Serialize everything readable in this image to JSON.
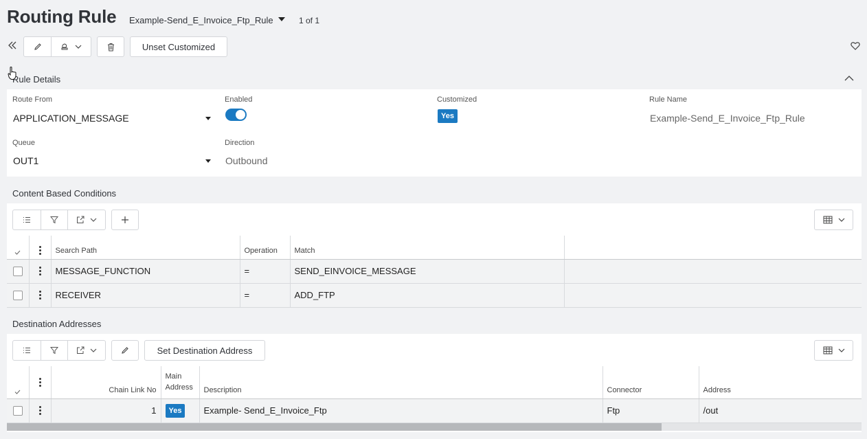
{
  "header": {
    "title": "Routing Rule",
    "record_name": "Example-Send_E_Invoice_Ftp_Rule",
    "paging": "1 of 1"
  },
  "toolbar": {
    "unset_customized_label": "Unset Customized"
  },
  "rule_details": {
    "title": "Rule Details",
    "route_from_label": "Route From",
    "route_from_value": "APPLICATION_MESSAGE",
    "enabled_label": "Enabled",
    "enabled": true,
    "customized_label": "Customized",
    "customized_value": "Yes",
    "rule_name_label": "Rule Name",
    "rule_name_value": "Example-Send_E_Invoice_Ftp_Rule",
    "queue_label": "Queue",
    "queue_value": "OUT1",
    "direction_label": "Direction",
    "direction_value": "Outbound"
  },
  "conditions": {
    "title": "Content Based Conditions",
    "columns": [
      "Search Path",
      "Operation",
      "Match"
    ],
    "rows": [
      {
        "search_path": "MESSAGE_FUNCTION",
        "operation": "=",
        "match": "SEND_EINVOICE_MESSAGE"
      },
      {
        "search_path": "RECEIVER",
        "operation": "=",
        "match": "ADD_FTP"
      }
    ]
  },
  "destinations": {
    "title": "Destination Addresses",
    "set_destination_label": "Set Destination Address",
    "columns": [
      "Chain Link No",
      "Main Address",
      "Description",
      "Connector",
      "Address"
    ],
    "rows": [
      {
        "chain_link_no": "1",
        "main_address": "Yes",
        "description": "Example- Send_E_Invoice_Ftp",
        "connector": "Ftp",
        "address": "/out"
      }
    ]
  },
  "colors": {
    "accent": "#1b7ac2",
    "badge": "#1b7ac2"
  }
}
